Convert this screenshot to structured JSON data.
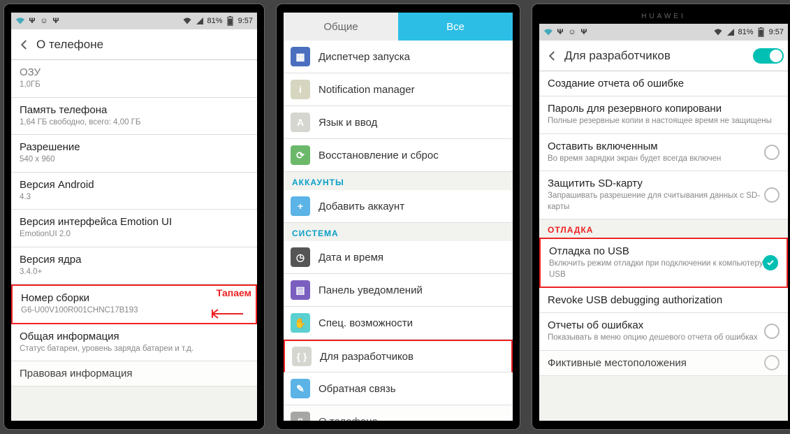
{
  "status": {
    "battery": "81%",
    "time": "9:57"
  },
  "p1": {
    "title": "О телефоне",
    "annotation": "Тапаем",
    "items": [
      {
        "label": "ОЗУ",
        "sub": "1,0ГБ"
      },
      {
        "label": "Память телефона",
        "sub": "1,64 ГБ свободно, всего: 4,00 ГБ"
      },
      {
        "label": "Разрешение",
        "sub": "540 x 960"
      },
      {
        "label": "Версия Android",
        "sub": "4.3"
      },
      {
        "label": "Версия интерфейса Emotion UI",
        "sub": "EmotionUI 2.0"
      },
      {
        "label": "Версия ядра",
        "sub": "3.4.0+"
      },
      {
        "label": "Номер сборки",
        "sub": "G6-U00V100R001CHNC17B193"
      },
      {
        "label": "Общая информация",
        "sub": "Статус батареи, уровень заряда батареи и т.д."
      },
      {
        "label": "Правовая информация",
        "sub": ""
      }
    ]
  },
  "p2": {
    "tabs": {
      "inactive": "Общие",
      "active": "Все"
    },
    "sections": {
      "accounts": "АККАУНТЫ",
      "system": "СИСТЕМА"
    },
    "rows": [
      {
        "label": "Диспетчер запуска",
        "icon": "dispatch"
      },
      {
        "label": "Notification manager",
        "icon": "info"
      },
      {
        "label": "Язык и ввод",
        "icon": "lang"
      },
      {
        "label": "Восстановление и сброс",
        "icon": "restore"
      },
      {
        "label": "Добавить аккаунт",
        "icon": "add"
      },
      {
        "label": "Дата и время",
        "icon": "clock"
      },
      {
        "label": "Панель уведомлений",
        "icon": "panel"
      },
      {
        "label": "Спец. возможности",
        "icon": "hand"
      },
      {
        "label": "Для разработчиков",
        "icon": "dev"
      },
      {
        "label": "Обратная связь",
        "icon": "feedback"
      },
      {
        "label": "О телефоне",
        "icon": "about"
      }
    ]
  },
  "p3": {
    "brand": "HUAWEI",
    "title": "Для разработчиков",
    "section_debug": "ОТЛАДКА",
    "items": [
      {
        "label": "Создание отчета об ошибке",
        "sub": ""
      },
      {
        "label": "Пароль для резервного копировани",
        "sub": "Полные резервные копии в настоящее время не защищены"
      },
      {
        "label": "Оставить включенным",
        "sub": "Во время зарядки экран будет всегда включен"
      },
      {
        "label": "Защитить SD-карту",
        "sub": "Запрашивать разрешение для считывания данных с SD-карты"
      },
      {
        "label": "Отладка по USB",
        "sub": "Включить режим отладки при подключении к компьютеру по USB"
      },
      {
        "label": "Revoke USB debugging authorization",
        "sub": ""
      },
      {
        "label": "Отчеты об ошибках",
        "sub": "Показывать в меню опцию дешевого отчета об ошибках"
      },
      {
        "label": "Фиктивные местоположения",
        "sub": ""
      }
    ]
  }
}
